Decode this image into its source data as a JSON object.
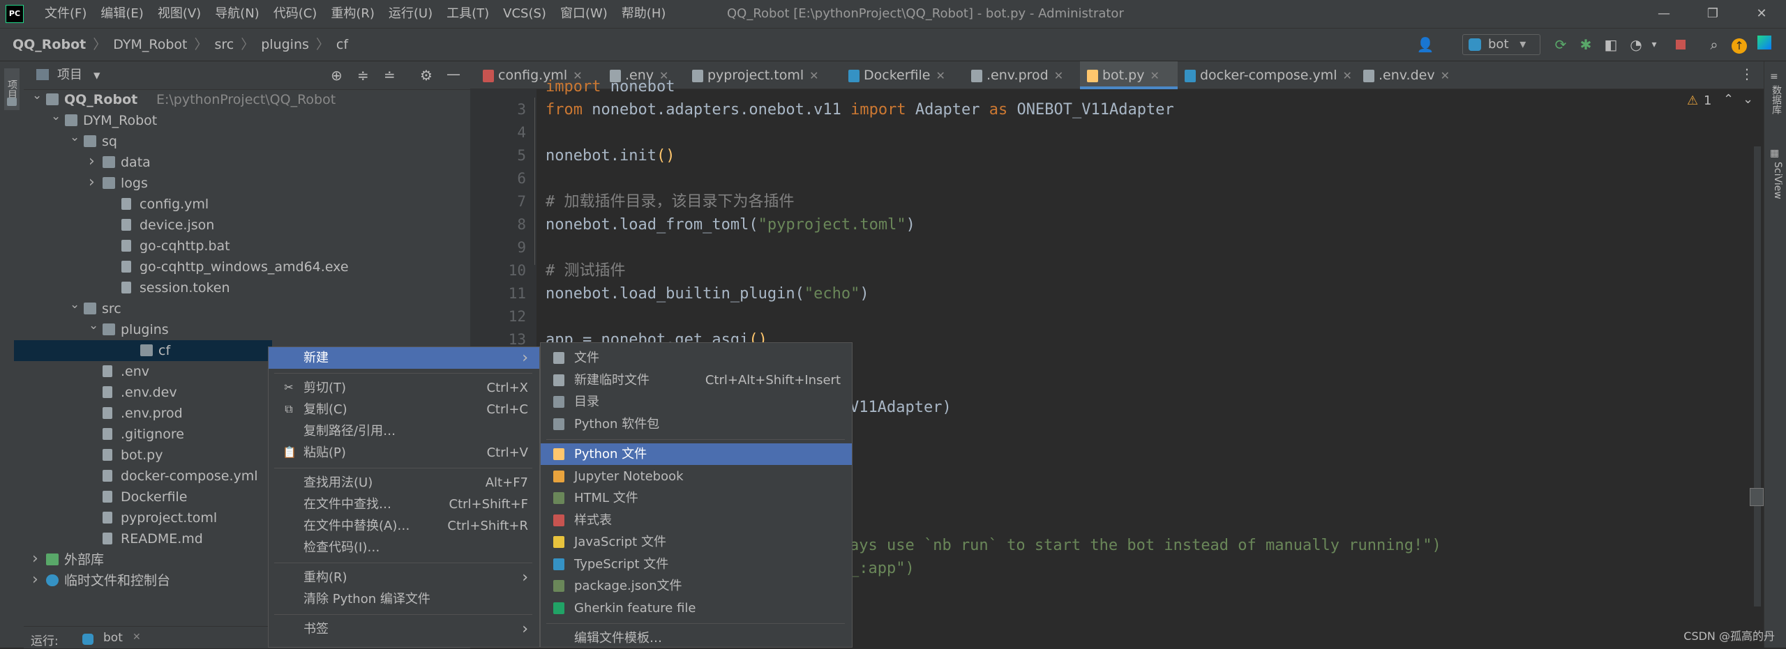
{
  "menubar": {
    "logo": "PC",
    "items": [
      "文件(F)",
      "编辑(E)",
      "视图(V)",
      "导航(N)",
      "代码(C)",
      "重构(R)",
      "运行(U)",
      "工具(T)",
      "VCS(S)",
      "窗口(W)",
      "帮助(H)"
    ],
    "window_title": "QQ_Robot [E:\\pythonProject\\QQ_Robot] - bot.py - Administrator",
    "minimize": "—",
    "restore": "❐",
    "close": "✕"
  },
  "navbar": {
    "crumbs": [
      "QQ_Robot",
      "DYM_Robot",
      "src",
      "plugins",
      "cf"
    ],
    "run_config": "bot",
    "icons": [
      "user-icon",
      "run-icon",
      "debug-icon",
      "coverage-icon",
      "profile-icon",
      "stop-icon",
      "search-icon",
      "update-icon",
      "jetbrains-icon"
    ]
  },
  "left_stripe": {
    "label": "项目"
  },
  "project": {
    "title": "项目",
    "tree": [
      {
        "label": "QQ_Robot",
        "path": "E:\\pythonProject\\QQ_Robot",
        "depth": 0,
        "type": "folder",
        "expanded": true
      },
      {
        "label": "DYM_Robot",
        "depth": 1,
        "type": "folder",
        "expanded": true
      },
      {
        "label": "sq",
        "depth": 2,
        "type": "folder",
        "expanded": true
      },
      {
        "label": "data",
        "depth": 3,
        "type": "folder",
        "expanded": false
      },
      {
        "label": "logs",
        "depth": 3,
        "type": "folder",
        "expanded": false
      },
      {
        "label": "config.yml",
        "depth": 4,
        "type": "file"
      },
      {
        "label": "device.json",
        "depth": 4,
        "type": "file"
      },
      {
        "label": "go-cqhttp.bat",
        "depth": 4,
        "type": "file"
      },
      {
        "label": "go-cqhttp_windows_amd64.exe",
        "depth": 4,
        "type": "file"
      },
      {
        "label": "session.token",
        "depth": 4,
        "type": "file"
      },
      {
        "label": "src",
        "depth": 2,
        "type": "folder",
        "expanded": true
      },
      {
        "label": "plugins",
        "depth": 3,
        "type": "folder",
        "expanded": true
      },
      {
        "label": "cf",
        "depth": 5,
        "type": "folder",
        "selected": true
      },
      {
        "label": ".env",
        "depth": 3,
        "type": "file"
      },
      {
        "label": ".env.dev",
        "depth": 3,
        "type": "file"
      },
      {
        "label": ".env.prod",
        "depth": 3,
        "type": "file"
      },
      {
        "label": ".gitignore",
        "depth": 3,
        "type": "file"
      },
      {
        "label": "bot.py",
        "depth": 3,
        "type": "file"
      },
      {
        "label": "docker-compose.yml",
        "depth": 3,
        "type": "file"
      },
      {
        "label": "Dockerfile",
        "depth": 3,
        "type": "file"
      },
      {
        "label": "pyproject.toml",
        "depth": 3,
        "type": "file"
      },
      {
        "label": "README.md",
        "depth": 3,
        "type": "file"
      },
      {
        "label": "外部库",
        "depth": 0,
        "type": "library",
        "expanded": false
      },
      {
        "label": "临时文件和控制台",
        "depth": 0,
        "type": "scratch",
        "expanded": false
      }
    ]
  },
  "runbar": {
    "label": "运行:",
    "config": "bot",
    "close": "✕"
  },
  "tabs": [
    {
      "label": "config.yml",
      "color": "#c75450"
    },
    {
      "label": ".env",
      "color": "#9aa4aa"
    },
    {
      "label": "pyproject.toml",
      "color": "#9aa4aa"
    },
    {
      "label": "Dockerfile",
      "color": "#3592c4"
    },
    {
      "label": ".env.prod",
      "color": "#9aa4aa"
    },
    {
      "label": "bot.py",
      "color": "#ffc66d",
      "active": true
    },
    {
      "label": "docker-compose.yml",
      "color": "#3592c4"
    },
    {
      "label": ".env.dev",
      "color": "#9aa4aa"
    }
  ],
  "editor": {
    "warning_count": "1",
    "lines": [
      {
        "n": "",
        "text": "import nonebot"
      },
      {
        "n": "3",
        "text": "from nonebot.adapters.onebot.v11 import Adapter as ONEBOT_V11Adapter"
      },
      {
        "n": "4",
        "text": ""
      },
      {
        "n": "5",
        "text": "nonebot.init()"
      },
      {
        "n": "6",
        "text": ""
      },
      {
        "n": "7",
        "text": "# 加载插件目录，该目录下为各插件"
      },
      {
        "n": "8",
        "text": "nonebot.load_from_toml(\"pyproject.toml\")"
      },
      {
        "n": "9",
        "text": ""
      },
      {
        "n": "10",
        "text": "# 测试插件"
      },
      {
        "n": "11",
        "text": "nonebot.load_builtin_plugin(\"echo\")"
      },
      {
        "n": "12",
        "text": ""
      },
      {
        "n": "13",
        "text": "app = nonebot.get_asgi()"
      }
    ],
    "fragments": {
      "adapter": "V11Adapter)",
      "run_msg": "ays use `nb run` to start the bot instead of manually running!\")",
      "app_ref": "_:app\")"
    }
  },
  "right_stripe": {
    "db": "数据库",
    "sciview": "SciView"
  },
  "context_menu": {
    "items": [
      {
        "label": "新建",
        "submenu": true,
        "highlight": true
      },
      {
        "sep": true
      },
      {
        "label": "剪切(T)",
        "shortcut": "Ctrl+X",
        "icon": "✂"
      },
      {
        "label": "复制(C)",
        "shortcut": "Ctrl+C",
        "icon": "⧉"
      },
      {
        "label": "复制路径/引用…"
      },
      {
        "label": "粘贴(P)",
        "shortcut": "Ctrl+V",
        "icon": "📋"
      },
      {
        "sep": true
      },
      {
        "label": "查找用法(U)",
        "shortcut": "Alt+F7"
      },
      {
        "label": "在文件中查找…",
        "shortcut": "Ctrl+Shift+F"
      },
      {
        "label": "在文件中替换(A)…",
        "shortcut": "Ctrl+Shift+R"
      },
      {
        "label": "检查代码(I)…"
      },
      {
        "sep": true
      },
      {
        "label": "重构(R)",
        "submenu": true
      },
      {
        "label": "清除 Python 编译文件"
      },
      {
        "sep": true
      },
      {
        "label": "书签",
        "submenu": true
      }
    ]
  },
  "submenu": {
    "items": [
      {
        "label": "文件",
        "icon_color": "#9aa4aa"
      },
      {
        "label": "新建临时文件",
        "shortcut": "Ctrl+Alt+Shift+Insert",
        "icon_color": "#9aa4aa"
      },
      {
        "label": "目录",
        "icon_color": "#87939a"
      },
      {
        "label": "Python 软件包",
        "icon_color": "#87939a"
      },
      {
        "sep": true
      },
      {
        "label": "Python 文件",
        "icon_color": "#ffc66d",
        "highlight": true
      },
      {
        "label": "Jupyter Notebook",
        "icon_color": "#e8a33d"
      },
      {
        "label": "HTML 文件",
        "icon_color": "#6a8759"
      },
      {
        "label": "样式表",
        "icon_color": "#c75450"
      },
      {
        "label": "JavaScript 文件",
        "icon_color": "#e8c33d"
      },
      {
        "label": "TypeScript 文件",
        "icon_color": "#3592c4"
      },
      {
        "label": "package.json文件",
        "icon_color": "#6a8759"
      },
      {
        "label": "Gherkin feature file",
        "icon_color": "#21a366"
      },
      {
        "sep": true
      },
      {
        "label": "编辑文件模板…"
      }
    ]
  },
  "watermark": "CSDN @孤高的丹"
}
